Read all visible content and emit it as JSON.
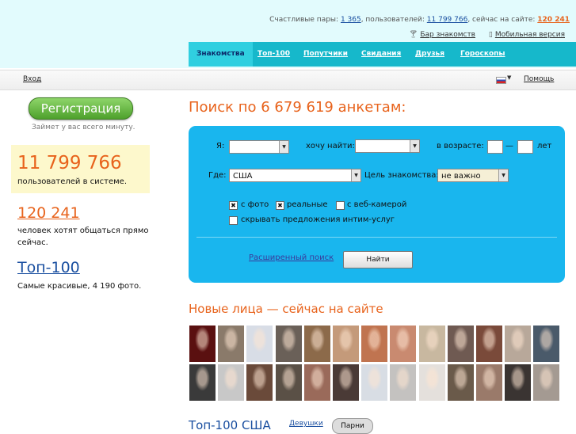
{
  "header": {
    "stats_prefix": "Счастливые пары: ",
    "happy_pairs": "1 365",
    "users_label": ", пользователей: ",
    "users": "11 799 766",
    "online_label": ", сейчас на сайте: ",
    "online": "120 241",
    "bar_link": "Бар знакомств",
    "mobile_link": "Мобильная версия"
  },
  "nav": {
    "tabs": [
      {
        "label": "Знакомства",
        "active": true
      },
      {
        "label": "Топ-100"
      },
      {
        "label": "Попутчики"
      },
      {
        "label": "Свидания"
      },
      {
        "label": "Друзья"
      },
      {
        "label": "Гороскопы"
      }
    ]
  },
  "loginbar": {
    "login": "Вход",
    "help": "Помощь",
    "language_flag": "ru-flag-icon"
  },
  "sidebar": {
    "register_button": "Регистрация",
    "register_sub": "Займет у вас всего минуту.",
    "users_count": "11 799 766",
    "users_text": "пользователей в системе.",
    "online_count": "120 241",
    "online_text": "человек хотят общаться прямо сейчас.",
    "top_title": "Топ-100",
    "top_text": "Самые красивые, 4 190 фото."
  },
  "search": {
    "title": "Поиск по 6 679 619 анкетам:",
    "i_label": "Я:",
    "i_value": "",
    "find_label": "хочу найти:",
    "find_value": "",
    "age_label": "в возрасте:",
    "age_from": "",
    "age_dash": "—",
    "age_to": "",
    "years_label": "лет",
    "where_label": "Где:",
    "where_value": "США",
    "goal_label": "Цель знакомства:",
    "goal_value": "не важно",
    "opt_photo": "с фото",
    "opt_photo_checked": true,
    "opt_real": "реальные",
    "opt_real_checked": true,
    "opt_webcam": "с веб-камерой",
    "opt_webcam_checked": false,
    "opt_hide": "скрывать предложения интим-услуг",
    "opt_hide_checked": false,
    "advanced_link": "Расширенный поиск",
    "find_button": "Найти",
    "check_mark": "✖"
  },
  "faces": {
    "title": "Новые лица — сейчас на сайте",
    "row1_colors": [
      "#5a1010",
      "#8a7a6a",
      "#d8dde6",
      "#6a6058",
      "#8c6a4a",
      "#c49a7a",
      "#c07450",
      "#c98a70",
      "#c8b8a0",
      "#6f5a52",
      "#7a4a3a",
      "#b8a89a",
      "#4a5a6a"
    ],
    "row2_colors": [
      "#3a3a3a",
      "#c8c8c8",
      "#6a4a3a",
      "#5a5046",
      "#9a6a5a",
      "#4a3a36",
      "#d8dde4",
      "#c4c2c0",
      "#e4e0dc",
      "#6a5a4a",
      "#9a7a6a",
      "#3a3432",
      "#a49a92"
    ]
  },
  "top": {
    "title": "Топ-100 США",
    "girls": "Девушки",
    "boys": "Парни"
  }
}
